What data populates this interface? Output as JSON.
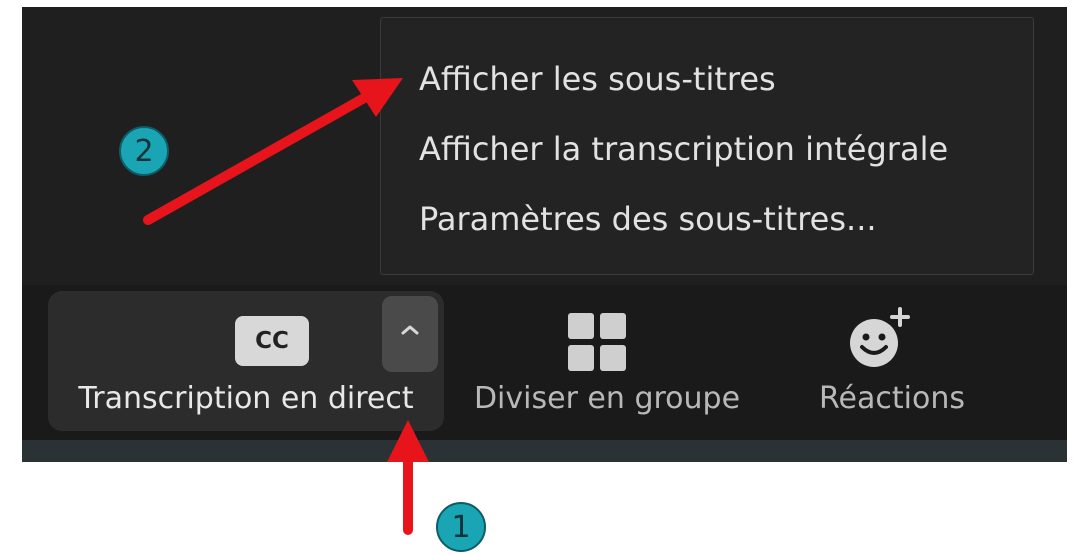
{
  "menu": {
    "items": [
      {
        "label": "Afficher les sous-titres"
      },
      {
        "label": "Afficher la transcription intégrale"
      },
      {
        "label": "Paramètres des sous-titres..."
      }
    ]
  },
  "toolbar": {
    "transcription": {
      "icon_text": "CC",
      "label": "Transcription en direct"
    },
    "groups": {
      "label": "Diviser en groupe"
    },
    "reactions": {
      "label": "Réactions"
    }
  },
  "annotations": {
    "step1": "1",
    "step2": "2"
  },
  "colors": {
    "window_bg": "#1f1f1f",
    "menu_text": "#e2e2e2",
    "label_active": "#e8e8e8",
    "label_inactive": "#b8b8b8",
    "arrow": "#e8141c",
    "badge": "#1aa5b5"
  }
}
